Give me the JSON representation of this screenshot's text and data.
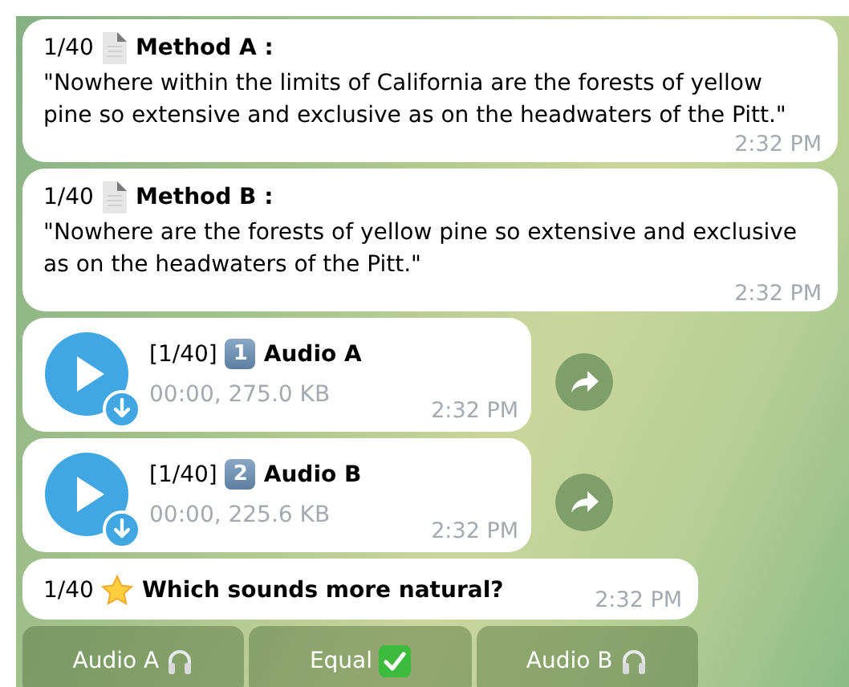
{
  "messages": [
    {
      "kind": "text",
      "counter": "1/40",
      "title": "Method A :",
      "body": "\"Nowhere within the limits of California are the forests of yellow pine so extensive and exclusive as on the headwaters of the Pitt.\"",
      "time": "2:32 PM"
    },
    {
      "kind": "text",
      "counter": "1/40",
      "title": "Method B :",
      "body": "\"Nowhere are the forests of yellow pine so extensive and exclusive as on the headwaters of the Pitt.\"",
      "time": "2:32 PM"
    },
    {
      "kind": "audio",
      "counter": "[1/40]",
      "number": "1",
      "title": "Audio A",
      "meta": "00:00, 275.0 KB",
      "time": "2:32 PM"
    },
    {
      "kind": "audio",
      "counter": "[1/40]",
      "number": "2",
      "title": "Audio B",
      "meta": "00:00, 225.6 KB",
      "time": "2:32 PM"
    },
    {
      "kind": "question",
      "counter": "1/40",
      "title": "Which sounds more natural?",
      "time": "2:32 PM"
    }
  ],
  "keyboard": [
    {
      "label": "Audio A",
      "kind": "headphones"
    },
    {
      "label": "Equal",
      "kind": "check"
    },
    {
      "label": "Audio B",
      "kind": "headphones"
    }
  ]
}
